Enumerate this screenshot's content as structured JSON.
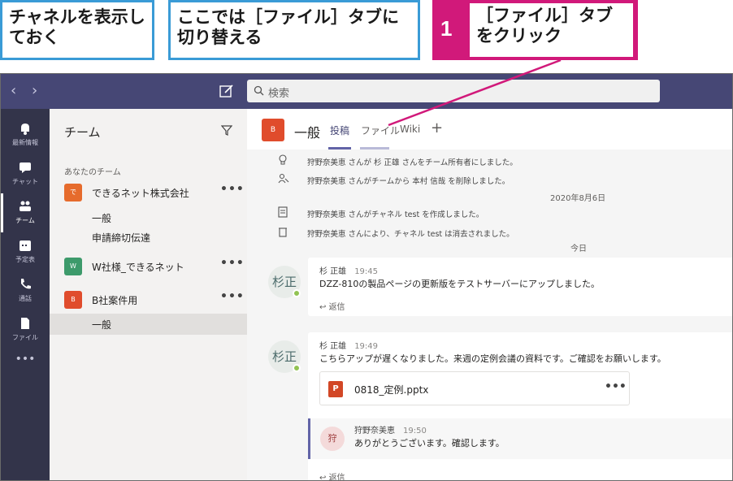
{
  "callouts": {
    "callout1": "チャネルを表示しておく",
    "callout2": "ここでは［ファイル］タブに切り替える",
    "step_number": "1",
    "step_text": "［ファイル］タブをクリック"
  },
  "titlebar": {
    "back": "‹",
    "forward": "›",
    "search_placeholder": "検索"
  },
  "rail": {
    "items": [
      {
        "label": "最新情報",
        "icon": "bell-icon"
      },
      {
        "label": "チャット",
        "icon": "chat-icon"
      },
      {
        "label": "チーム",
        "icon": "teams-icon"
      },
      {
        "label": "予定表",
        "icon": "calendar-icon"
      },
      {
        "label": "通話",
        "icon": "phone-icon"
      },
      {
        "label": "ファイル",
        "icon": "file-icon"
      }
    ],
    "more": "•••"
  },
  "panel": {
    "title": "チーム",
    "section": "あなたのチーム",
    "teams": [
      {
        "name": "できるネット株式会社",
        "avatar": "で",
        "color": "#e66b2c",
        "channels": [
          "一般",
          "申請締切伝達"
        ]
      },
      {
        "name": "W社様_できるネット",
        "avatar": "W",
        "color": "#3d9a6b",
        "channels": []
      },
      {
        "name": "B社案件用",
        "avatar": "B",
        "color": "#e04c2c",
        "channels": [
          "一般"
        ]
      }
    ],
    "more": "•••"
  },
  "channel": {
    "avatar": "B",
    "name": "一般",
    "tabs": [
      "投稿",
      "ファイル",
      "Wiki",
      "+"
    ]
  },
  "activity": [
    {
      "icon": "bulb-icon",
      "text": "狩野奈美恵 さんが 杉 正雄 さんをチーム所有者にしました。"
    },
    {
      "icon": "people-remove-icon",
      "text": "狩野奈美恵 さんがチームから 本村 信哉 を削除しました。"
    },
    {
      "icon": "channel-create-icon",
      "text": "狩野奈美恵 さんがチャネル test を作成しました。"
    },
    {
      "icon": "trash-icon",
      "text": "狩野奈美恵 さんにより、チャネル test は消去されました。"
    }
  ],
  "dates": {
    "date1": "2020年8月6日",
    "today": "今日"
  },
  "messages": [
    {
      "avatar": "杉正",
      "author": "杉 正雄",
      "time": "19:45",
      "text": "DZZ-810の製品ページの更新版をテストサーバーにアップしました。",
      "reply": "返信"
    },
    {
      "avatar": "杉正",
      "author": "杉 正雄",
      "time": "19:49",
      "text": "こちらアップが遅くなりました。来週の定例会議の資料です。ご確認をお願いします。",
      "attachment": {
        "icon": "P",
        "name": "0818_定例.pptx",
        "more": "•••"
      },
      "thread": {
        "avatar": "狩",
        "author": "狩野奈美恵",
        "time": "19:50",
        "text": "ありがとうございます。確認します。"
      },
      "reply": "返信"
    }
  ],
  "colors": {
    "callout_border": "#3a9bd6",
    "step_bg": "#d1197a",
    "titlebar": "#464775",
    "rail": "#33344a",
    "accent": "#6264a7"
  }
}
